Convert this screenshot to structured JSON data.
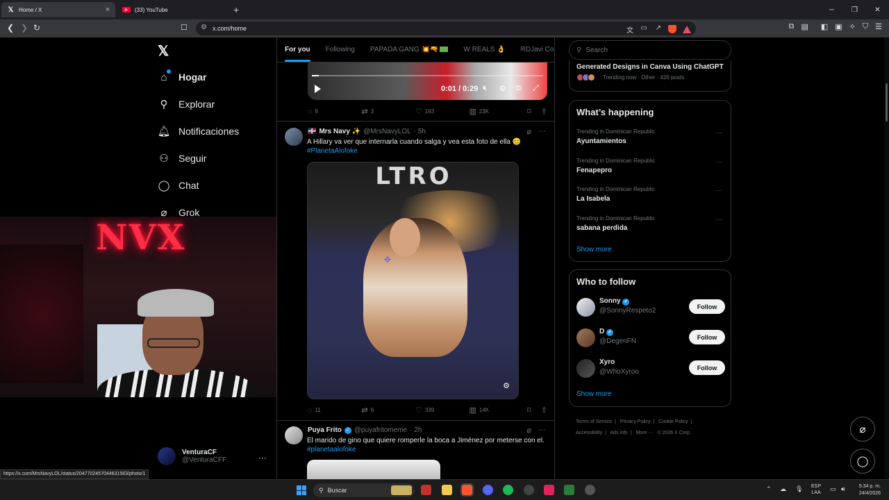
{
  "browser": {
    "tabs": [
      {
        "title": "Home / X",
        "active": true
      },
      {
        "title": "(33) YouTube",
        "active": false
      }
    ],
    "url": "x.com/home",
    "status_url": "https://x.com/MrsNavyLOL/status/2047702457044631563/photo/1"
  },
  "sidebar": {
    "items": [
      {
        "label": "Hogar",
        "icon": "home-icon"
      },
      {
        "label": "Explorar",
        "icon": "search-icon"
      },
      {
        "label": "Notificaciones",
        "icon": "bell-icon"
      },
      {
        "label": "Seguir",
        "icon": "person-add-icon"
      },
      {
        "label": "Chat",
        "icon": "chat-icon"
      },
      {
        "label": "Grok",
        "icon": "grok-icon"
      }
    ],
    "account": {
      "name": "VenturaCF",
      "handle": "@VenturaCFF"
    }
  },
  "webcam": {
    "sign": "NVX"
  },
  "feed": {
    "tabs": [
      "For you",
      "Following",
      "PAPADA GANG",
      "W REALS",
      "RDJavi Cor"
    ],
    "video": {
      "time": "0:01 / 0:29",
      "progress": 0.03
    },
    "post0_actions": {
      "replies": "8",
      "reposts": "3",
      "likes": "193",
      "views": "23K"
    },
    "post1": {
      "name": "Mrs Navy ✨",
      "handle": "@MrsNavyLOL",
      "time": "· 5h",
      "text": "A Hillary va ver que internarla cuando salga y vea esta foto de ella 😊",
      "hashtag": "#PlanetaAlofoke",
      "media_sign": "LTRO",
      "actions": {
        "replies": "11",
        "reposts": "6",
        "likes": "339",
        "views": "14K"
      }
    },
    "post2": {
      "name": "Puya Frito",
      "handle": "@puyafritomeme",
      "time": "· 2h",
      "text": "El marido de gino que quiere romperle la boca a Jiménez por meterse con el.",
      "hashtag": "#planetaalofoke"
    }
  },
  "right": {
    "search_placeholder": "Search",
    "generated": {
      "title": "Generated Designs in Canva Using ChatGPT",
      "meta": "Trending now · Other · 420 posts"
    },
    "happening": {
      "title": "What’s happening",
      "trends": [
        {
          "context": "Trending in Dominican Republic",
          "name": "Ayuntamientos"
        },
        {
          "context": "Trending in Dominican Republic",
          "name": "Fenapepro"
        },
        {
          "context": "Trending in Dominican Republic",
          "name": "La Isabela"
        },
        {
          "context": "Trending in Dominican Republic",
          "name": "sabana perdida"
        }
      ],
      "show_more": "Show more"
    },
    "who_to_follow": {
      "title": "Who to follow",
      "accounts": [
        {
          "name": "Sonny",
          "handle": "@SonnyRespeto2",
          "verified": true
        },
        {
          "name": "D",
          "handle": "@DegenFN",
          "verified": true
        },
        {
          "name": "Xyro",
          "handle": "@WhoXyroo",
          "verified": false
        }
      ],
      "follow_label": "Follow",
      "show_more": "Show more"
    },
    "footer": [
      "Terms of Service",
      "|",
      "Privacy Policy",
      "|",
      "Cookie Policy",
      "|",
      "Accessibility",
      "|",
      "Ads info",
      "|",
      "More ···",
      "© 2026 X Corp."
    ]
  },
  "taskbar": {
    "search": "Buscar",
    "lang": [
      "ESP",
      "LAA"
    ],
    "time": "5:34 p. m.",
    "date": "24/4/2026"
  }
}
